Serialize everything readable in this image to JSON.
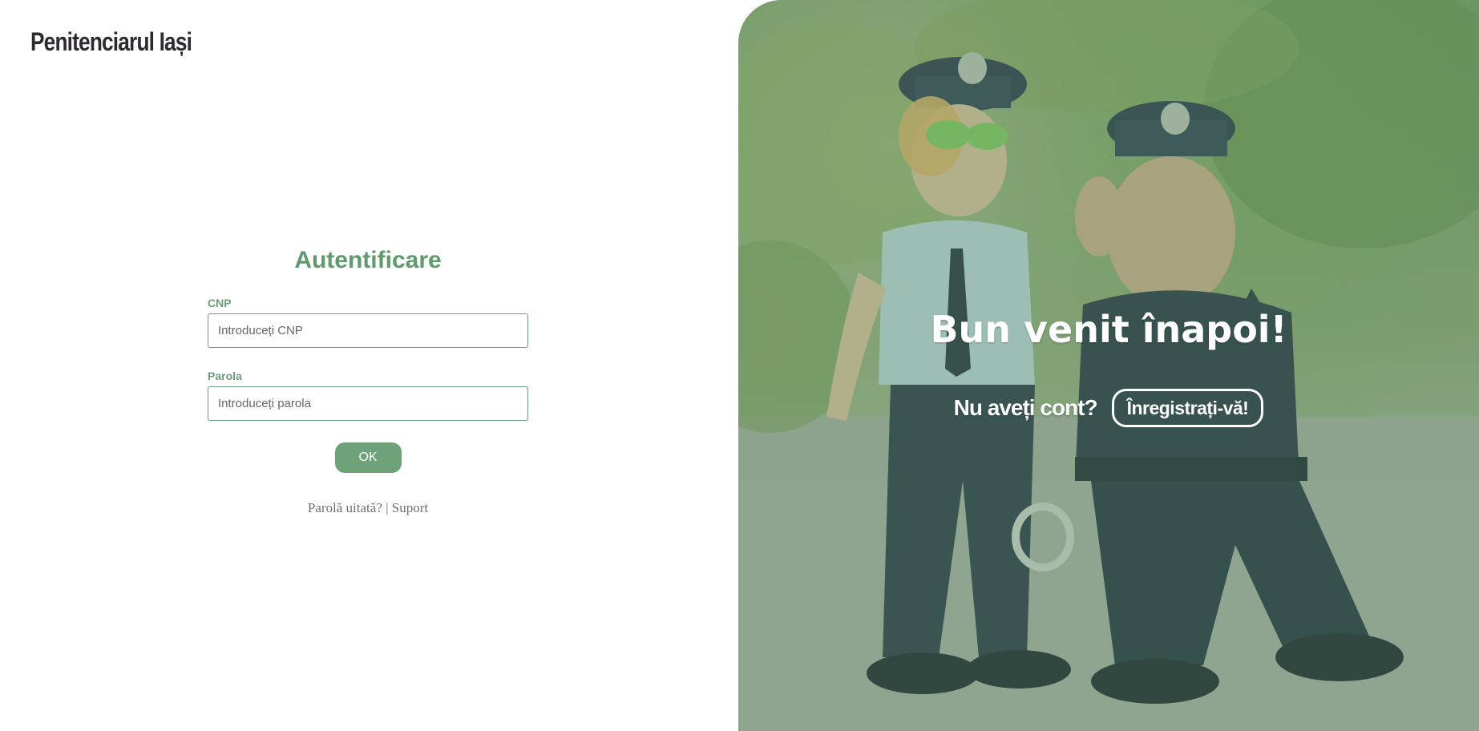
{
  "brand": {
    "name": "Penitenciarul Iași"
  },
  "login": {
    "title": "Autentificare",
    "cnp_label": "CNP",
    "cnp_placeholder": "Introduceți CNP",
    "password_label": "Parola",
    "password_placeholder": "Introduceți parola",
    "submit_label": "OK",
    "forgot_password_link": "Parolă uitată?",
    "separator": "|",
    "support_link": "Suport"
  },
  "welcome": {
    "title": "Bun venit înapoi!",
    "no_account_text": "Nu aveți cont?",
    "register_button": "Înregistrați-vă!"
  },
  "colors": {
    "accent_green": "#6ea37a",
    "label_green": "#5e9a6c",
    "brand_text": "#2f2a30"
  }
}
